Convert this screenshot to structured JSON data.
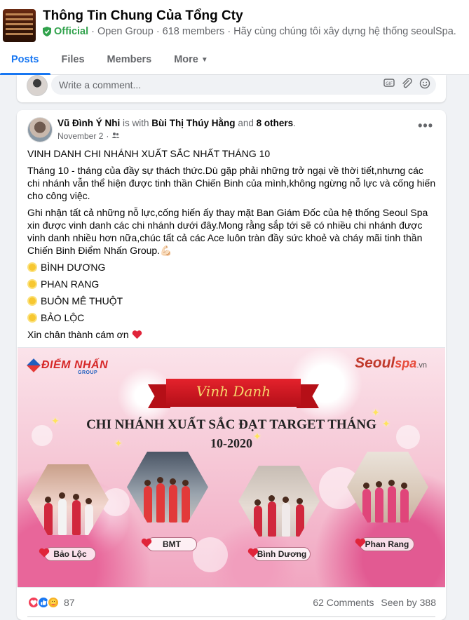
{
  "group": {
    "title": "Thông Tin Chung Của Tổng Cty",
    "official": "Official",
    "privacy": "Open Group",
    "members": "618 members",
    "description": "Hãy cùng chúng tôi xây dựng hệ thống seoulSpa.",
    "shield_icon": "shield-check-icon",
    "accent": "#1877f2",
    "official_color": "#31a24c"
  },
  "tabs": [
    {
      "label": "Posts",
      "active": true
    },
    {
      "label": "Files",
      "active": false
    },
    {
      "label": "Members",
      "active": false
    },
    {
      "label": "More",
      "active": false
    }
  ],
  "comment_box": {
    "placeholder": "Write a comment...",
    "icons": [
      "gif-icon",
      "attach-icon",
      "emoji-icon"
    ]
  },
  "post": {
    "author": "Vũ Đình Ý Nhi",
    "with_text": "is with",
    "tagged": "Bùi Thị Thúy Hằng",
    "and_text": "and",
    "others": "8 others",
    "date": "November 2",
    "audience_icon": "group-audience-icon",
    "menu_icon": "more-horiz-icon",
    "headline": "VINH DANH CHI NHÁNH XUẤT SẮC NHẤT THÁNG 10",
    "paragraph1": "Tháng 10 - tháng của đầy sự thách thức.Dù gặp phải những trở ngại về thời tiết,nhưng các chi nhánh vẫn thể hiện được tinh thần Chiến Binh của mình,không ngừng nỗ lực và cống hiến cho công việc.",
    "paragraph2": "Ghi nhận tất cả những nỗ lực,cống hiến ấy thay mặt Ban Giám Đốc của hệ thống Seoul Spa xin được vinh danh các chi nhánh dưới đây.Mong rằng sắp tới sẽ có nhiều chi nhánh được vinh danh nhiều hơn nữa,chúc tất cả các Ace luôn tràn đầy sức khoẻ và cháy mãi tinh thần Chiến Binh Điểm Nhấn Group.",
    "branches": [
      "BÌNH DƯƠNG",
      "PHAN RANG",
      "BUÔN MÊ THUỘT",
      "BẢO LỘC"
    ],
    "closing": "Xin chân thành cám ơn"
  },
  "banner": {
    "logo_left": "ĐIỂM NHẤN",
    "logo_left_sub": "GROUP",
    "logo_right_seoul": "Seoul",
    "logo_right_spa": "spa",
    "logo_right_vn": ".vn",
    "ribbon": "Vinh Danh",
    "headline1": "CHI NHÁNH XUẤT SẮC ĐẠT TARGET THÁNG",
    "headline2": "10-2020",
    "labels": [
      "Bảo Lộc",
      "BMT",
      "Bình Dương",
      "Phan Rang"
    ]
  },
  "footer": {
    "reaction_count": "87",
    "comments": "62 Comments",
    "seen": "Seen by 388",
    "reaction_icons": [
      "love-reaction-icon",
      "like-reaction-icon",
      "care-reaction-icon"
    ]
  }
}
